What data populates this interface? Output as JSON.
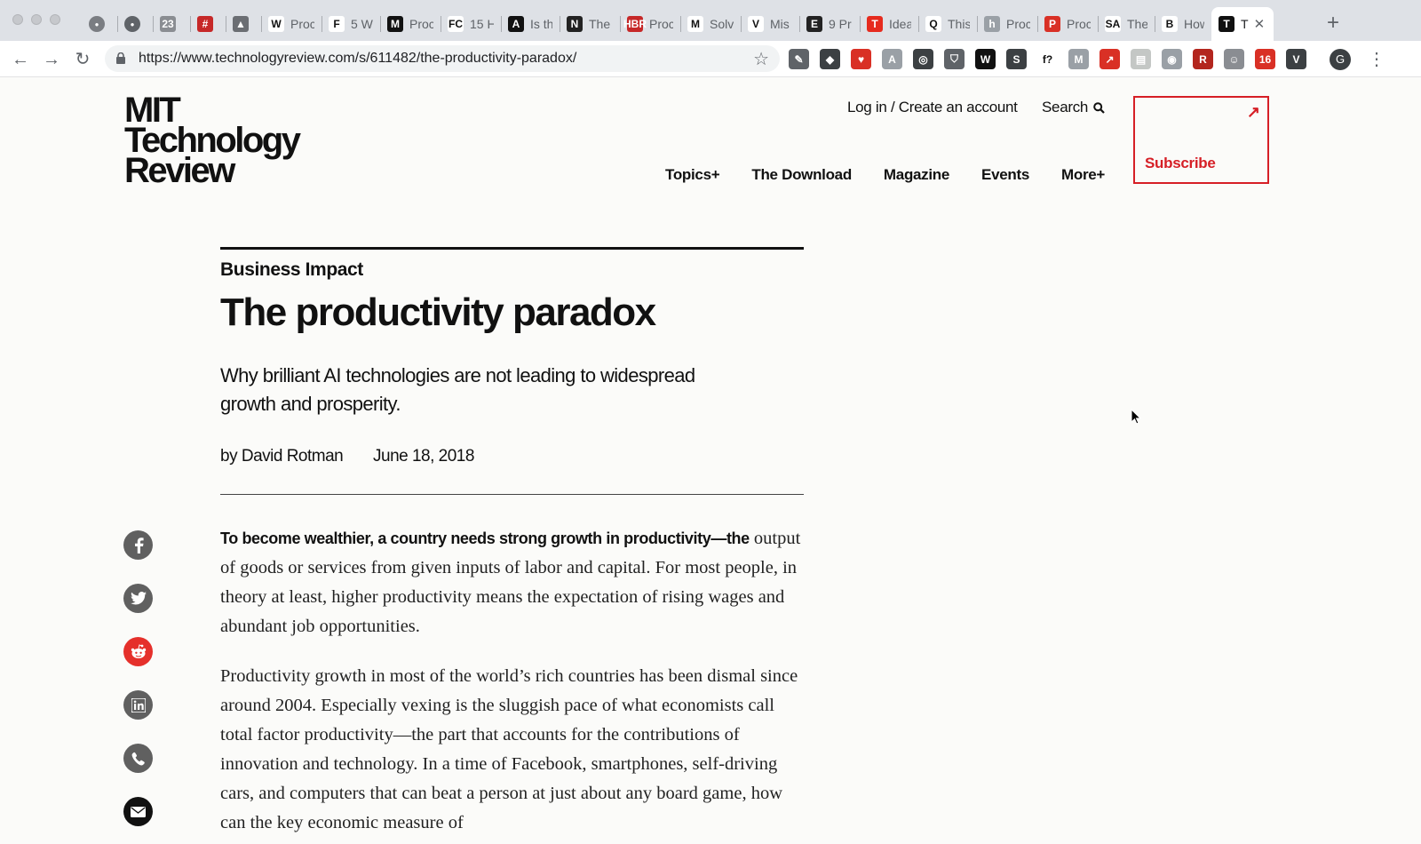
{
  "browser": {
    "tabs": [
      {
        "title": "",
        "icon": "chat-icon",
        "color": "#7a7d82"
      },
      {
        "title": "",
        "icon": "help-icon",
        "color": "#5f6368"
      },
      {
        "title": "",
        "icon": "calendar-icon",
        "color": "#8a8d92",
        "glyph": "23"
      },
      {
        "title": "",
        "icon": "hash-icon",
        "color": "#c62828",
        "glyph": "#"
      },
      {
        "title": "",
        "icon": "drive-icon",
        "color": "#6b6e73",
        "glyph": "▲"
      },
      {
        "title": "Proc",
        "icon": "wikipedia-icon",
        "color": "#ffffff",
        "glyph": "W",
        "dark": true
      },
      {
        "title": "5 W",
        "icon": "forbes-icon",
        "color": "#ffffff",
        "glyph": "F",
        "dark": true
      },
      {
        "title": "Proc",
        "icon": "medium-icon",
        "color": "#111111",
        "glyph": "M"
      },
      {
        "title": "15 H",
        "icon": "fastcompany-icon",
        "color": "#ffffff",
        "glyph": "FC",
        "dark": true
      },
      {
        "title": "Is th",
        "icon": "atlantic-icon",
        "color": "#111111",
        "glyph": "A"
      },
      {
        "title": "The",
        "icon": "newyorker-icon",
        "color": "#222222",
        "glyph": "N"
      },
      {
        "title": "Proc",
        "icon": "hbr-icon",
        "color": "#c62828",
        "glyph": "HBR"
      },
      {
        "title": "Solv",
        "icon": "mckinsey-icon",
        "color": "#ffffff",
        "glyph": "M",
        "dark": true
      },
      {
        "title": "Mis",
        "icon": "vox-icon",
        "color": "#ffffff",
        "glyph": "V",
        "dark": true
      },
      {
        "title": "9 Pr",
        "icon": "economist-icon",
        "color": "#222222",
        "glyph": "E"
      },
      {
        "title": "Idea",
        "icon": "tedtalks-icon",
        "color": "#e62b1e",
        "glyph": "T"
      },
      {
        "title": "This",
        "icon": "quartz-icon",
        "color": "#ffffff",
        "glyph": "Q",
        "dark": true
      },
      {
        "title": "Proc",
        "icon": "hn-icon",
        "color": "#9aa0a6",
        "glyph": "h"
      },
      {
        "title": "Proc",
        "icon": "pocket-red-icon",
        "color": "#d93025",
        "glyph": "P"
      },
      {
        "title": "The",
        "icon": "sciam-icon",
        "color": "#ffffff",
        "glyph": "SA",
        "dark": true
      },
      {
        "title": "How",
        "icon": "bloomberg-icon",
        "color": "#ffffff",
        "glyph": "B",
        "dark": true
      },
      {
        "title": "T",
        "icon": "technologyreview-icon",
        "color": "#111111",
        "glyph": "T",
        "active": true
      }
    ],
    "url": "https://www.technologyreview.com/s/611482/the-productivity-paradox/",
    "extensions": [
      {
        "icon": "pen-tool-icon",
        "color": "#5f6368",
        "glyph": "✎"
      },
      {
        "icon": "pocket-icon",
        "color": "#3c4043",
        "glyph": "◆"
      },
      {
        "icon": "heart-clip-icon",
        "color": "#d93025",
        "glyph": "♥"
      },
      {
        "icon": "reader-icon",
        "color": "#9aa0a6",
        "glyph": "A"
      },
      {
        "icon": "compass-icon",
        "color": "#3c4043",
        "glyph": "◎"
      },
      {
        "icon": "shield-icon",
        "color": "#5f6368",
        "glyph": "⛉"
      },
      {
        "icon": "wolfram-icon",
        "color": "#111111",
        "glyph": "W"
      },
      {
        "icon": "scribd-icon",
        "color": "#3c4043",
        "glyph": "S"
      },
      {
        "icon": "function-icon",
        "color": "#ffffff",
        "glyph": "f?",
        "dark": true
      },
      {
        "icon": "gmail-icon",
        "color": "#9aa0a6",
        "glyph": "M"
      },
      {
        "icon": "arrow-red-icon",
        "color": "#d93025",
        "glyph": "↗"
      },
      {
        "icon": "doc-icon",
        "color": "#c4c7c5",
        "glyph": "▤"
      },
      {
        "icon": "rss-icon",
        "color": "#9aa0a6",
        "glyph": "◉"
      },
      {
        "icon": "r-icon",
        "color": "#b3261e",
        "glyph": "R"
      },
      {
        "icon": "robot-icon",
        "color": "#8a8d92",
        "glyph": "☺"
      },
      {
        "icon": "badge-icon",
        "color": "#d93025",
        "glyph": "16"
      },
      {
        "icon": "v-icon",
        "color": "#3c4043",
        "glyph": "V"
      }
    ],
    "profile_initial": "G"
  },
  "site": {
    "logo_lines": [
      "MIT",
      "Technology",
      "Review"
    ],
    "account": "Log in / Create an account",
    "search": "Search",
    "nav": [
      "Topics+",
      "The Download",
      "Magazine",
      "Events",
      "More+"
    ],
    "subscribe": "Subscribe"
  },
  "article": {
    "section": "Business Impact",
    "title": "The productivity paradox",
    "dek": "Why brilliant AI technologies are not leading to widespread growth and prosperity.",
    "author": "by David Rotman",
    "date": "June 18, 2018",
    "lead": "To become wealthier, a country needs strong growth in productivity—the",
    "p1_rest": "output of goods or services from given inputs of labor and capital. For most people, in theory at least, higher productivity means the expectation of rising wages and abundant job opportunities.",
    "p2": "Productivity growth in most of the world’s rich countries has been dismal since around 2004. Especially vexing is the sluggish pace of what economists call total factor productivity—the part that accounts for the contributions of innovation and technology. In a time of Facebook, smartphones, self-driving cars, and computers that can beat a person at just about any board game, how can the key economic measure of"
  },
  "share": [
    "facebook-icon",
    "twitter-icon",
    "reddit-icon",
    "linkedin-icon",
    "whatsapp-icon",
    "email-icon"
  ]
}
